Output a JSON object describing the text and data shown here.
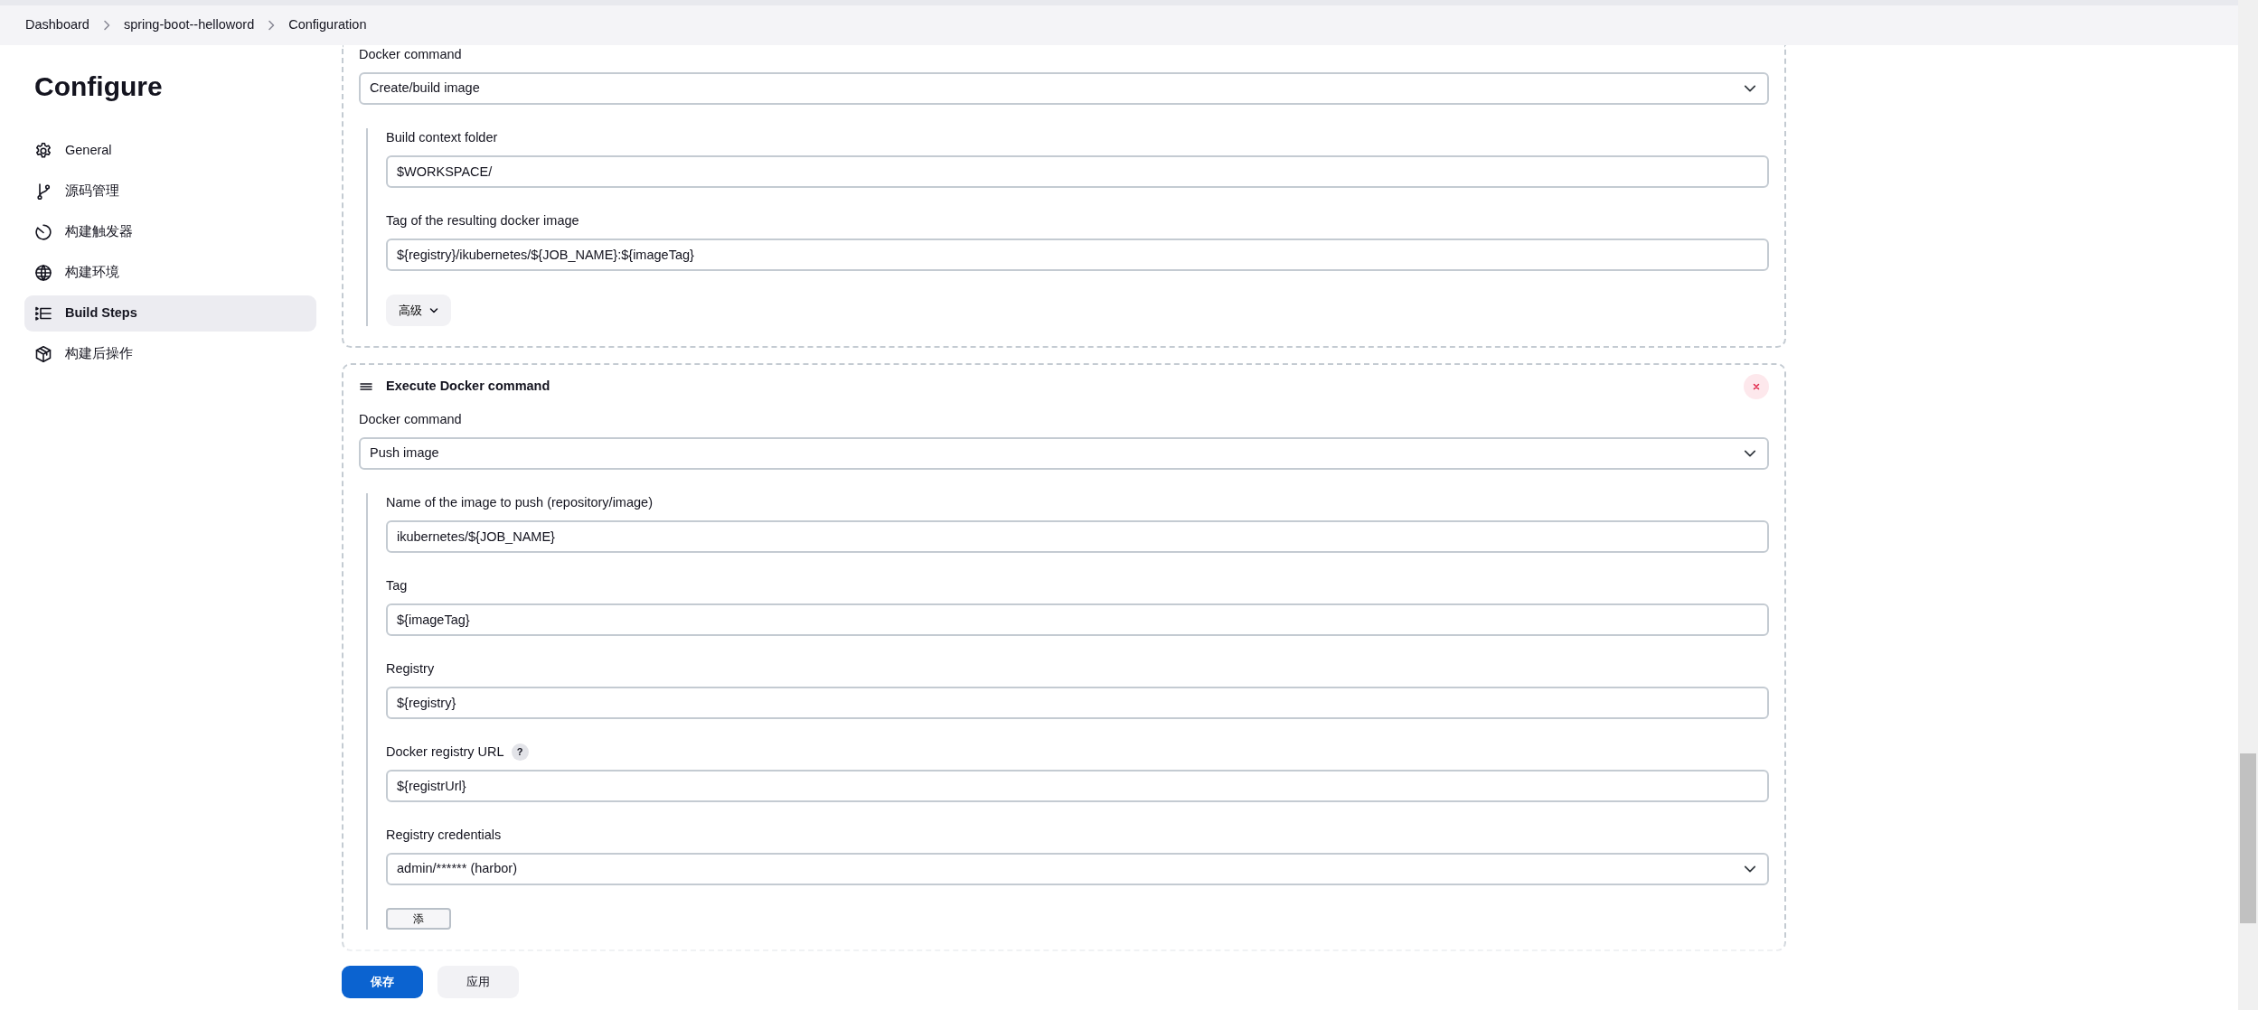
{
  "breadcrumbs": [
    {
      "label": "Dashboard"
    },
    {
      "label": "spring-boot--helloword"
    },
    {
      "label": "Configuration"
    }
  ],
  "sidebar": {
    "title": "Configure",
    "items": [
      {
        "label": "General",
        "selected": false
      },
      {
        "label": "源码管理",
        "selected": false
      },
      {
        "label": "构建触发器",
        "selected": false
      },
      {
        "label": "构建环境",
        "selected": false
      },
      {
        "label": "Build Steps",
        "selected": true
      },
      {
        "label": "构建后操作",
        "selected": false
      }
    ]
  },
  "build_steps": [
    {
      "fields": [
        {
          "kind": "select",
          "label": "Docker command",
          "value": "Create/build image"
        }
      ],
      "subfields": [
        {
          "kind": "text",
          "label": "Build context folder",
          "value": "$WORKSPACE/"
        },
        {
          "kind": "text",
          "label": "Tag of the resulting docker image",
          "value": "${registry}/ikubernetes/${JOB_NAME}:${imageTag}"
        }
      ],
      "advanced_button": "高级"
    },
    {
      "title": "Execute Docker command",
      "fields": [
        {
          "kind": "select",
          "label": "Docker command",
          "value": "Push image"
        }
      ],
      "subfields": [
        {
          "kind": "text",
          "label": "Name of the image to push (repository/image)",
          "value": "ikubernetes/${JOB_NAME}"
        },
        {
          "kind": "text",
          "label": "Tag",
          "value": "${imageTag}"
        },
        {
          "kind": "text",
          "label": "Registry",
          "value": "${registry}"
        },
        {
          "kind": "text",
          "label": "Docker registry URL",
          "help": "?",
          "value": "${registrUrl}"
        },
        {
          "kind": "select",
          "label": "Registry credentials",
          "value": "admin/****** (harbor)"
        }
      ],
      "add_button": "添"
    }
  ],
  "footer": {
    "buttons": [
      {
        "label": "保存",
        "kind": "primary"
      },
      {
        "label": "应用",
        "kind": "secondary"
      }
    ]
  }
}
